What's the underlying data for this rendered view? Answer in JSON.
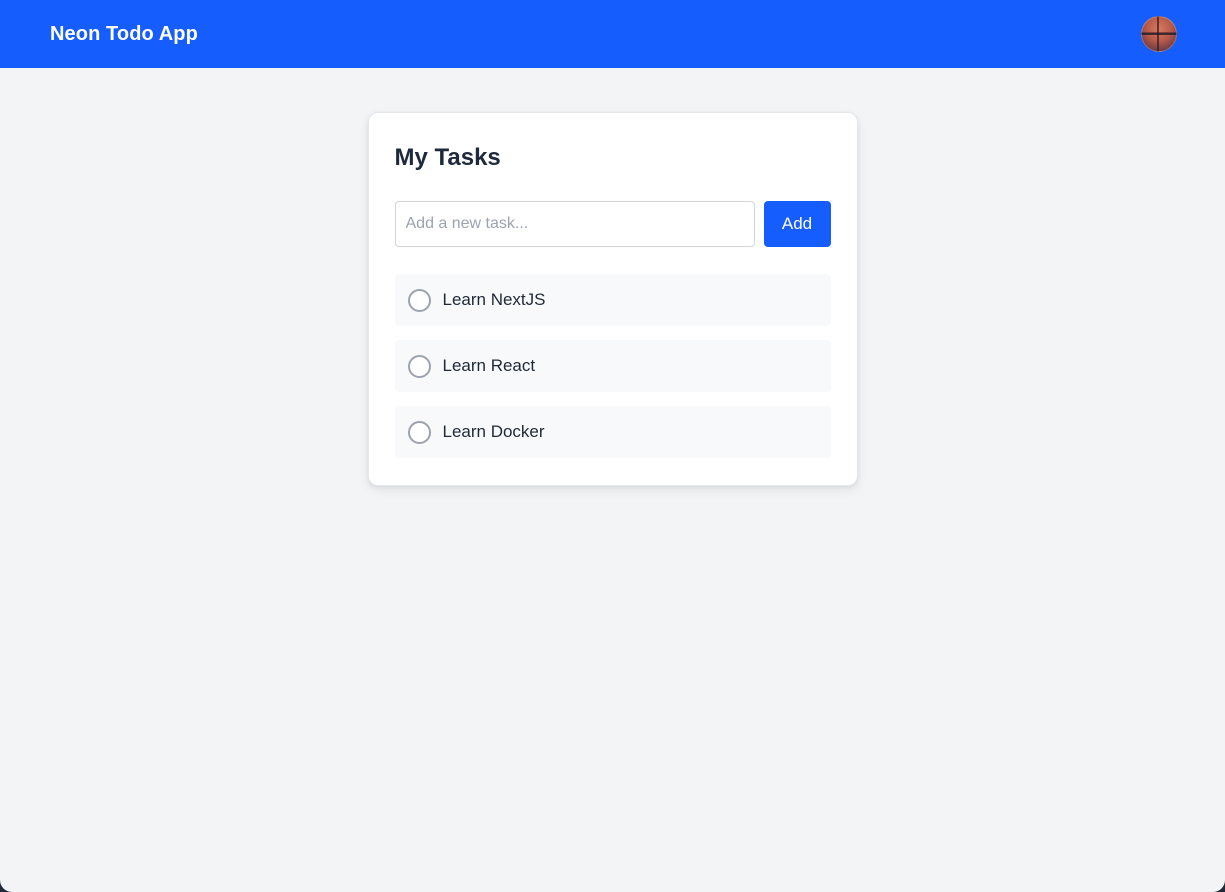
{
  "header": {
    "title": "Neon Todo App",
    "avatar_icon": "user-avatar"
  },
  "colors": {
    "accent": "#155dfc",
    "page_bg": "#f3f4f6",
    "card_bg": "#ffffff",
    "task_bg": "#f8f9fa"
  },
  "card": {
    "title": "My Tasks",
    "new_task": {
      "placeholder": "Add a new task...",
      "value": ""
    },
    "add_label": "Add",
    "tasks": [
      {
        "label": "Learn NextJS",
        "completed": false
      },
      {
        "label": "Learn React",
        "completed": false
      },
      {
        "label": "Learn Docker",
        "completed": false
      }
    ]
  }
}
